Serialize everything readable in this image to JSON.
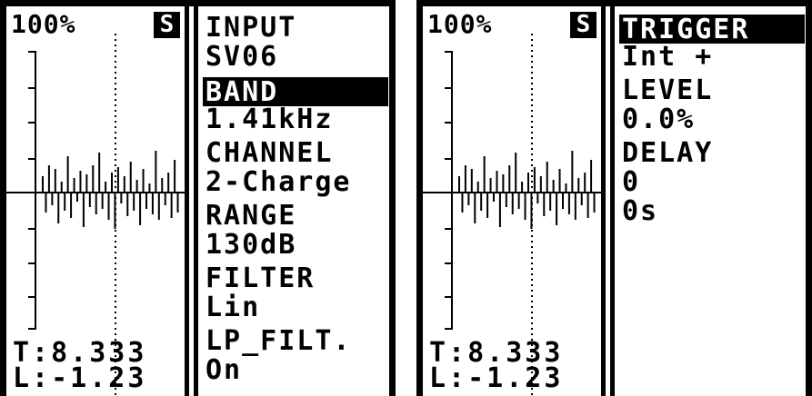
{
  "left_screen": {
    "percent": "100%",
    "s_badge": "S",
    "readout_t": "T:8.333",
    "readout_l": "L:-1.23",
    "params": [
      {
        "title": "INPUT",
        "value": "SV06",
        "selected": false
      },
      {
        "title": "BAND",
        "value": "1.41kHz",
        "selected": true
      },
      {
        "title": "CHANNEL",
        "value": "2-Charge",
        "selected": false
      },
      {
        "title": "RANGE",
        "value": "130dB",
        "selected": false
      },
      {
        "title": "FILTER",
        "value": "Lin",
        "selected": false
      },
      {
        "title": "LP_FILT.",
        "value": "On",
        "selected": false
      }
    ]
  },
  "right_screen": {
    "percent": "100%",
    "s_badge": "S",
    "readout_t": "T:8.333",
    "readout_l": "L:-1.23",
    "params": [
      {
        "title": "TRIGGER",
        "value": "Int +",
        "selected": true
      },
      {
        "title": "LEVEL",
        "value": "0.0%",
        "selected": false
      },
      {
        "title": "DELAY",
        "value": "0",
        "value2": "0s",
        "selected": false
      }
    ]
  },
  "colors": {
    "foreground": "#000000",
    "background": "#ffffff"
  }
}
